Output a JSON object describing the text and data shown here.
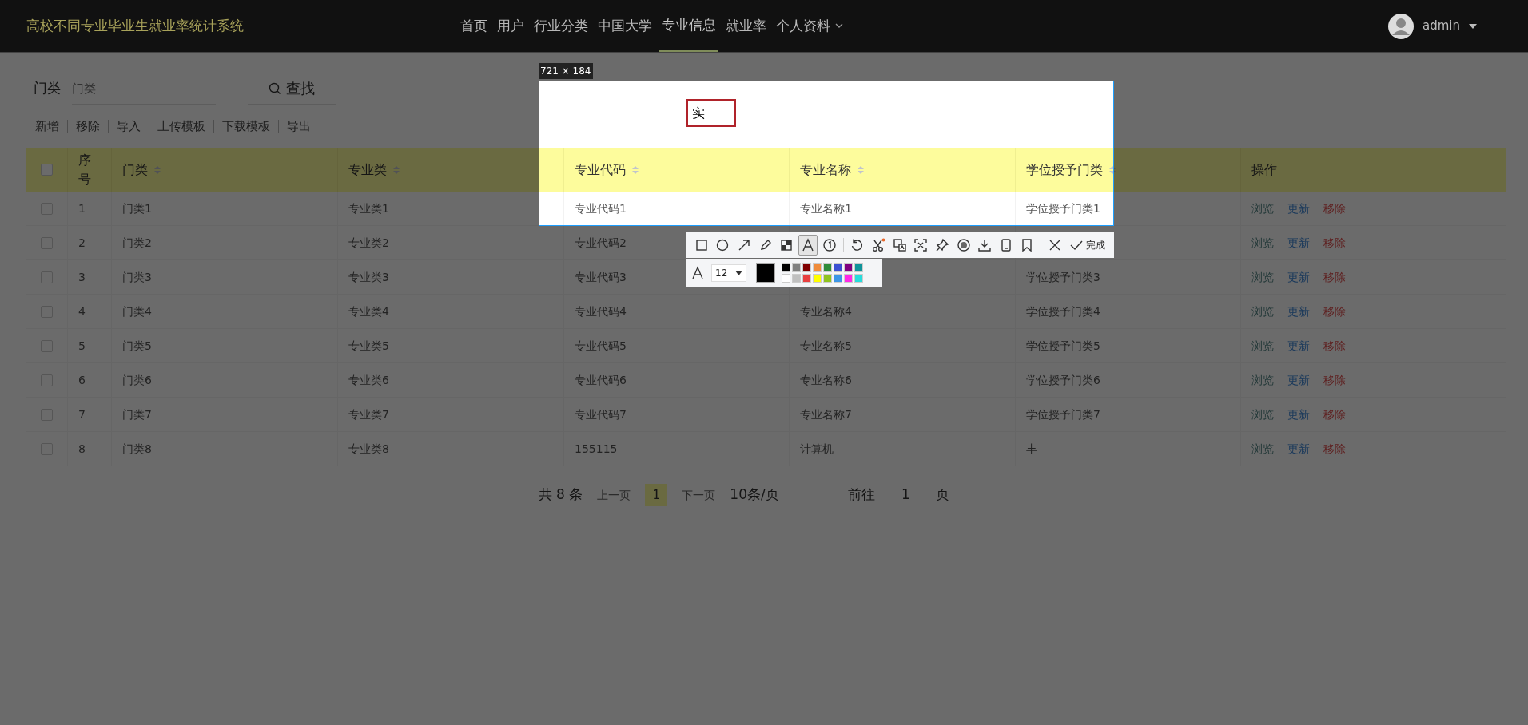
{
  "app_title": "高校不同专业毕业生就业率统计系统",
  "nav": [
    {
      "label": "首页",
      "selected": false,
      "dropdown": false
    },
    {
      "label": "用户",
      "selected": false,
      "dropdown": false
    },
    {
      "label": "行业分类",
      "selected": false,
      "dropdown": false
    },
    {
      "label": "中国大学",
      "selected": false,
      "dropdown": false
    },
    {
      "label": "专业信息",
      "selected": true,
      "dropdown": false
    },
    {
      "label": "就业率",
      "selected": false,
      "dropdown": false
    },
    {
      "label": "个人资料",
      "selected": false,
      "dropdown": true
    }
  ],
  "user": {
    "name": "admin"
  },
  "search": {
    "label": "门类",
    "placeholder": "门类",
    "button": "查找"
  },
  "actions": [
    "新增",
    "移除",
    "导入",
    "上传模板",
    "下载模板",
    "导出"
  ],
  "table": {
    "columns": [
      {
        "label": "序号",
        "sortable": false
      },
      {
        "label": "门类",
        "sortable": true
      },
      {
        "label": "专业类",
        "sortable": true
      },
      {
        "label": "专业代码",
        "sortable": true
      },
      {
        "label": "专业名称",
        "sortable": true
      },
      {
        "label": "学位授予门类",
        "sortable": true
      },
      {
        "label": "操作",
        "sortable": false
      }
    ],
    "select_all": {
      "checked": false
    },
    "rows": [
      {
        "checked": false,
        "cells": [
          "1",
          "门类1",
          "专业类1",
          "专业代码1",
          "专业名称1",
          "学位授予门类1"
        ],
        "actions": [
          {
            "kind": "view",
            "label": "浏览"
          },
          {
            "kind": "edit",
            "label": "更新"
          },
          {
            "kind": "delete",
            "label": "移除"
          }
        ]
      },
      {
        "checked": false,
        "cells": [
          "2",
          "门类2",
          "专业类2",
          "专业代码2",
          null,
          null
        ],
        "actions": [
          {
            "kind": "view",
            "label": "浏览"
          },
          {
            "kind": "edit",
            "label": "更新"
          },
          {
            "kind": "delete",
            "label": "移除"
          }
        ]
      },
      {
        "checked": false,
        "cells": [
          "3",
          "门类3",
          "专业类3",
          "专业代码3",
          null,
          "学位授予门类3"
        ],
        "actions": [
          {
            "kind": "view",
            "label": "浏览"
          },
          {
            "kind": "edit",
            "label": "更新"
          },
          {
            "kind": "delete",
            "label": "移除"
          }
        ]
      },
      {
        "checked": false,
        "cells": [
          "4",
          "门类4",
          "专业类4",
          "专业代码4",
          "专业名称4",
          "学位授予门类4"
        ],
        "actions": [
          {
            "kind": "view",
            "label": "浏览"
          },
          {
            "kind": "edit",
            "label": "更新"
          },
          {
            "kind": "delete",
            "label": "移除"
          }
        ]
      },
      {
        "checked": false,
        "cells": [
          "5",
          "门类5",
          "专业类5",
          "专业代码5",
          "专业名称5",
          "学位授予门类5"
        ],
        "actions": [
          {
            "kind": "view",
            "label": "浏览"
          },
          {
            "kind": "edit",
            "label": "更新"
          },
          {
            "kind": "delete",
            "label": "移除"
          }
        ]
      },
      {
        "checked": false,
        "cells": [
          "6",
          "门类6",
          "专业类6",
          "专业代码6",
          "专业名称6",
          "学位授予门类6"
        ],
        "actions": [
          {
            "kind": "view",
            "label": "浏览"
          },
          {
            "kind": "edit",
            "label": "更新"
          },
          {
            "kind": "delete",
            "label": "移除"
          }
        ]
      },
      {
        "checked": false,
        "cells": [
          "7",
          "门类7",
          "专业类7",
          "专业代码7",
          "专业名称7",
          "学位授予门类7"
        ],
        "actions": [
          {
            "kind": "view",
            "label": "浏览"
          },
          {
            "kind": "edit",
            "label": "更新"
          },
          {
            "kind": "delete",
            "label": "移除"
          }
        ]
      },
      {
        "checked": false,
        "cells": [
          "8",
          "门类8",
          "专业类8",
          "155115",
          "计算机",
          "丰"
        ],
        "actions": [
          {
            "kind": "view",
            "label": "浏览"
          },
          {
            "kind": "edit",
            "label": "更新"
          },
          {
            "kind": "delete",
            "label": "移除"
          }
        ]
      }
    ]
  },
  "pagination": {
    "total": "共 8 条",
    "prev": "上一页",
    "pages": [
      {
        "label": "1",
        "selected": true
      }
    ],
    "next": "下一页",
    "page_size": "10条/页",
    "goto": "前往",
    "goto_value": "1",
    "goto_suffix": "页"
  },
  "capture": {
    "size_label": "721 × 184",
    "text_box": "实",
    "tool_groups": [
      [
        {
          "kind": "rectangle",
          "selected": false
        },
        {
          "kind": "ellipse",
          "selected": false
        },
        {
          "kind": "arrow",
          "selected": false
        },
        {
          "kind": "pencil",
          "selected": false
        },
        {
          "kind": "mosaic",
          "selected": false
        },
        {
          "kind": "text",
          "selected": true
        },
        {
          "kind": "number",
          "selected": false
        }
      ],
      [
        {
          "kind": "undo",
          "selected": false
        },
        {
          "kind": "cut",
          "selected": false
        },
        {
          "kind": "translate",
          "selected": false
        },
        {
          "kind": "ocr",
          "selected": false
        },
        {
          "kind": "pin",
          "selected": false
        },
        {
          "kind": "record",
          "selected": false
        },
        {
          "kind": "save",
          "selected": false
        },
        {
          "kind": "phone",
          "selected": false
        },
        {
          "kind": "bookmark",
          "selected": false
        }
      ],
      [
        {
          "kind": "close",
          "selected": false
        },
        {
          "kind": "done",
          "label": "完成",
          "selected": false
        }
      ]
    ],
    "font_size": "12",
    "current_swatch": {
      "color": "#000000"
    },
    "palette": [
      {
        "color": "#000000"
      },
      {
        "color": "#808080"
      },
      {
        "color": "#800000"
      },
      {
        "color": "#f08c3c"
      },
      {
        "color": "#2e8b3a"
      },
      {
        "color": "#3c50d2"
      },
      {
        "color": "#800080"
      },
      {
        "color": "#10939a"
      },
      {
        "color": "#ffffff"
      },
      {
        "color": "#c0c0c0"
      },
      {
        "color": "#e84040"
      },
      {
        "color": "#ffff00"
      },
      {
        "color": "#8fc31f"
      },
      {
        "color": "#3c96e6"
      },
      {
        "color": "#ff28e6"
      },
      {
        "color": "#28dcdc"
      }
    ]
  }
}
